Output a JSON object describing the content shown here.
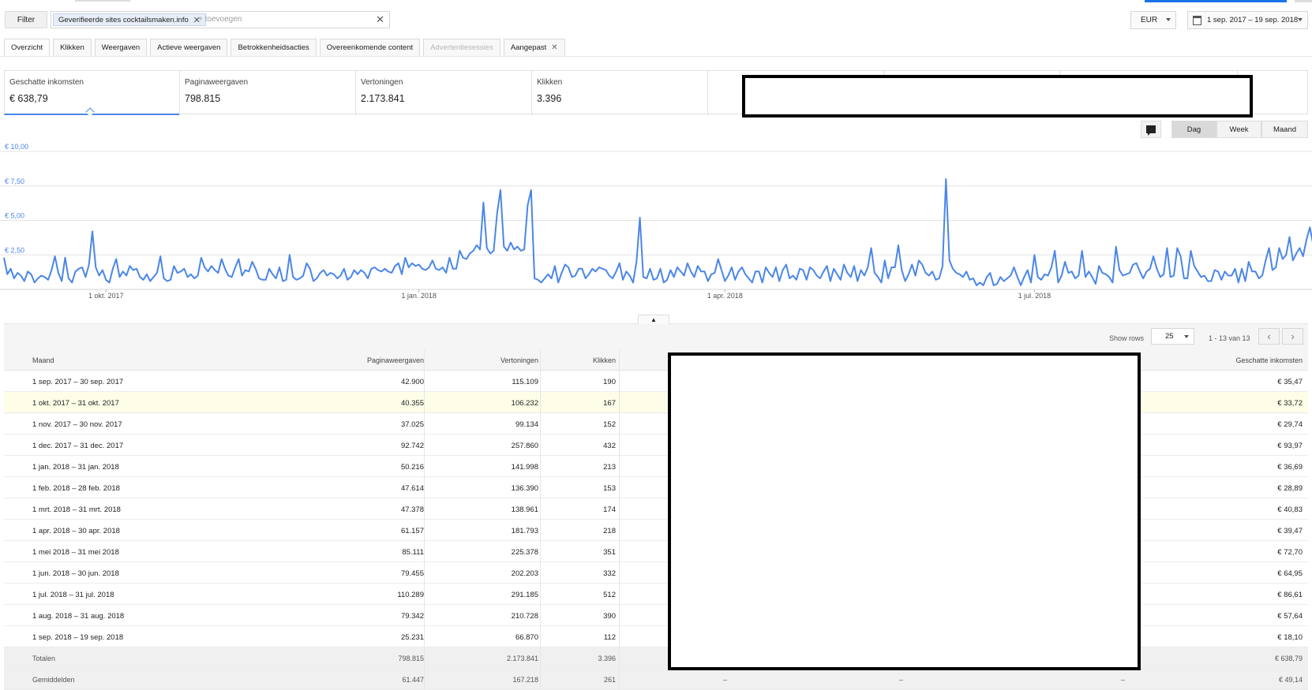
{
  "filter": {
    "button_label": "Filter",
    "chip_label": "Geverifieerde sites cocktailsmaken.info",
    "add_placeholder": "+ toevoegen"
  },
  "currency": "EUR",
  "date_range": "1 sep. 2017 – 19 sep. 2018",
  "tabs": [
    {
      "label": "Overzicht"
    },
    {
      "label": "Klikken"
    },
    {
      "label": "Weergaven"
    },
    {
      "label": "Actieve weergaven"
    },
    {
      "label": "Betrokkenheidsacties"
    },
    {
      "label": "Overeenkomende content"
    },
    {
      "label": "Advertentiesessies"
    },
    {
      "label": "Aangepast"
    }
  ],
  "metrics": [
    {
      "label": "Geschatte inkomsten",
      "value": "€ 638,79"
    },
    {
      "label": "Paginaweergaven",
      "value": "798.815"
    },
    {
      "label": "Vertoningen",
      "value": "2.173.841"
    },
    {
      "label": "Klikken",
      "value": "3.396"
    }
  ],
  "granularity": {
    "day": "Dag",
    "week": "Week",
    "month": "Maand",
    "selected": "Dag"
  },
  "chart_data": {
    "type": "line",
    "title": "",
    "xlabel": "",
    "ylabel": "",
    "ylim": [
      0,
      10
    ],
    "y_ticks": [
      "€ 10,00",
      "€ 7,50",
      "€ 5,00",
      "€ 2,50"
    ],
    "y_tick_values": [
      10,
      7.5,
      5,
      2.5
    ],
    "x_ticks": [
      "1 okt. 2017",
      "1 jan. 2018",
      "1 apr. 2018",
      "1 jul. 2018"
    ],
    "x_tick_index": [
      30,
      122,
      212,
      303
    ],
    "x_count": 384,
    "color": "#4a86e8",
    "series": [
      {
        "values": [
          2.3,
          1.1,
          1.5,
          0.8,
          1.2,
          1.0,
          0.6,
          1.3,
          1.1,
          0.5,
          0.8,
          1.0,
          0.9,
          0.7,
          1.4,
          2.4,
          1.2,
          0.6,
          2.3,
          0.8,
          0.5,
          1.3,
          1.5,
          1.6,
          0.9,
          1.8,
          4.2,
          1.6,
          1.0,
          1.4,
          0.7,
          0.5,
          1.5,
          2.2,
          0.9,
          1.3,
          1.0,
          1.7,
          1.4,
          1.5,
          0.9,
          0.7,
          1.1,
          0.6,
          0.9,
          1.2,
          2.4,
          0.8,
          0.6,
          0.7,
          1.7,
          1.2,
          1.3,
          1.5,
          0.9,
          1.1,
          0.8,
          1.0,
          2.3,
          1.6,
          1.3,
          1.7,
          1.4,
          1.2,
          2.2,
          1.5,
          1.0,
          0.9,
          1.6,
          2.2,
          1.0,
          1.4,
          1.3,
          2.0,
          1.5,
          0.8,
          0.7,
          0.7,
          1.5,
          1.1,
          0.8,
          1.6,
          0.6,
          0.7,
          2.5,
          0.9,
          0.7,
          0.8,
          1.0,
          1.9,
          1.5,
          0.6,
          0.8,
          1.2,
          1.4,
          1.0,
          1.2,
          1.1,
          0.8,
          1.0,
          1.5,
          0.7,
          0.9,
          1.4,
          1.1,
          1.4,
          1.2,
          0.8,
          1.5,
          1.6,
          1.4,
          1.3,
          1.5,
          1.3,
          1.2,
          1.7,
          1.9,
          1.1,
          2.3,
          1.6,
          1.9,
          1.7,
          1.8,
          1.5,
          1.4,
          1.6,
          2.1,
          1.5,
          1.4,
          1.6,
          1.2,
          2.3,
          1.5,
          1.5,
          2.8,
          2.3,
          2.2,
          2.6,
          2.8,
          3.2,
          2.9,
          6.3,
          3.0,
          2.6,
          2.8,
          5.5,
          7.2,
          3.1,
          2.8,
          3.4,
          2.9,
          3.1,
          2.8,
          2.9,
          6.1,
          7.2,
          0.8,
          0.7,
          0.5,
          0.8,
          1.1,
          0.8,
          1.7,
          0.5,
          1.2,
          1.8,
          1.6,
          0.9,
          1.0,
          1.5,
          1.5,
          0.8,
          1.1,
          1.5,
          1.3,
          1.6,
          1.5,
          1.4,
          1.0,
          0.8,
          1.3,
          1.9,
          0.7,
          1.3,
          1.0,
          0.5,
          2.0,
          5.2,
          0.9,
          0.8,
          1.5,
          0.7,
          0.8,
          1.5,
          0.5,
          0.7,
          1.4,
          0.9,
          1.6,
          1.3,
          1.0,
          1.9,
          1.3,
          0.9,
          1.7,
          1.3,
          1.3,
          0.6,
          1.1,
          1.2,
          2.2,
          1.4,
          0.6,
          1.0,
          1.6,
          0.7,
          1.3,
          1.6,
          1.1,
          0.8,
          0.5,
          1.3,
          1.3,
          0.5,
          1.6,
          1.2,
          0.9,
          1.6,
          0.6,
          1.4,
          1.8,
          0.8,
          1.0,
          0.7,
          1.5,
          1.4,
          0.7,
          1.6,
          1.4,
          1.0,
          0.8,
          1.3,
          1.7,
          0.6,
          1.5,
          1.1,
          0.7,
          1.8,
          1.2,
          0.9,
          1.7,
          0.6,
          1.4,
          1.0,
          1.6,
          3.0,
          1.2,
          0.9,
          0.5,
          2.1,
          0.8,
          1.6,
          1.6,
          3.2,
          1.4,
          0.6,
          1.1,
          1.8,
          1.0,
          2.1,
          1.8,
          1.2,
          1.0,
          1.3,
          0.7,
          0.8,
          1.7,
          8.0,
          2.1,
          1.5,
          1.2,
          1.1,
          0.9,
          1.3,
          0.7,
          0.8,
          0.3,
          0.5,
          0.3,
          0.9,
          1.2,
          0.3,
          0.4,
          0.9,
          0.6,
          0.8,
          1.0,
          1.6,
          0.9,
          0.3,
          0.9,
          1.4,
          0.5,
          2.5,
          0.9,
          0.7,
          1.1,
          1.0,
          1.6,
          2.8,
          0.5,
          1.0,
          2.0,
          1.2,
          1.3,
          0.8,
          1.0,
          2.8,
          0.9,
          1.3,
          0.9,
          0.4,
          1.7,
          1.2,
          1.1,
          0.9,
          0.5,
          3.1,
          1.4,
          1.0,
          1.1,
          1.2,
          1.8,
          1.9,
          1.3,
          0.8,
          1.3,
          1.5,
          2.4,
          1.5,
          0.9,
          1.1,
          3.0,
          0.9,
          1.0,
          3.0,
          2.4,
          0.8,
          0.8,
          2.8,
          1.7,
          1.3,
          0.9,
          1.0,
          0.6,
          0.6,
          1.4,
          1.3,
          0.7,
          1.3,
          1.0,
          1.0,
          1.5,
          0.5,
          1.5,
          0.6,
          2.0,
          1.3,
          1.3,
          0.8,
          1.0,
          2.1,
          3.0,
          1.4,
          1.6,
          3.0,
          2.2,
          2.5,
          3.8,
          2.1,
          2.6,
          3.0,
          2.4,
          3.6,
          4.5,
          3.2,
          2.6,
          3.0,
          3.5
        ]
      }
    ]
  },
  "table": {
    "show_rows_label": "Show rows",
    "rows_per_page": "25",
    "page_info": "1 - 13 van 13",
    "headers": {
      "month": "Maand",
      "pageviews": "Paginaweergaven",
      "impressions": "Vertoningen",
      "clicks": "Klikken",
      "earnings": "Geschatte inkomsten"
    },
    "rows": [
      {
        "month": "1 sep. 2017 – 30 sep. 2017",
        "pageviews": "42.900",
        "impressions": "115.109",
        "clicks": "190",
        "earnings": "€ 35,47"
      },
      {
        "month": "1 okt. 2017 – 31 okt. 2017",
        "pageviews": "40.355",
        "impressions": "106.232",
        "clicks": "167",
        "earnings": "€ 33,72"
      },
      {
        "month": "1 nov. 2017 – 30 nov. 2017",
        "pageviews": "37.025",
        "impressions": "99.134",
        "clicks": "152",
        "earnings": "€ 29,74"
      },
      {
        "month": "1 dec. 2017 – 31 dec. 2017",
        "pageviews": "92.742",
        "impressions": "257.860",
        "clicks": "432",
        "earnings": "€ 93,97"
      },
      {
        "month": "1 jan. 2018 – 31 jan. 2018",
        "pageviews": "50.216",
        "impressions": "141.998",
        "clicks": "213",
        "earnings": "€ 36,69"
      },
      {
        "month": "1 feb. 2018 – 28 feb. 2018",
        "pageviews": "47.614",
        "impressions": "136.390",
        "clicks": "153",
        "earnings": "€ 28,89"
      },
      {
        "month": "1 mrt. 2018 – 31 mrt. 2018",
        "pageviews": "47.378",
        "impressions": "138.961",
        "clicks": "174",
        "earnings": "€ 40,83"
      },
      {
        "month": "1 apr. 2018 – 30 apr. 2018",
        "pageviews": "61.157",
        "impressions": "181.793",
        "clicks": "218",
        "earnings": "€ 39,47"
      },
      {
        "month": "1 mei 2018 – 31 mei 2018",
        "pageviews": "85.111",
        "impressions": "225.378",
        "clicks": "351",
        "earnings": "€ 72,70"
      },
      {
        "month": "1 jun. 2018 – 30 jun. 2018",
        "pageviews": "79.455",
        "impressions": "202.203",
        "clicks": "332",
        "earnings": "€ 64,95"
      },
      {
        "month": "1 jul. 2018 – 31 jul. 2018",
        "pageviews": "110.289",
        "impressions": "291.185",
        "clicks": "512",
        "earnings": "€ 86,61"
      },
      {
        "month": "1 aug. 2018 – 31 aug. 2018",
        "pageviews": "79.342",
        "impressions": "210.728",
        "clicks": "390",
        "earnings": "€ 57,64"
      },
      {
        "month": "1 sep. 2018 – 19 sep. 2018",
        "pageviews": "25.231",
        "impressions": "66.870",
        "clicks": "112",
        "earnings": "€ 18,10"
      }
    ],
    "totals": {
      "label": "Totalen",
      "pageviews": "798.815",
      "impressions": "2.173.841",
      "clicks": "3.396",
      "earnings": "€ 638,79"
    },
    "averages": {
      "label": "Gemiddelden",
      "pageviews": "61.447",
      "impressions": "167.218",
      "clicks": "261",
      "dash1": "–",
      "dash2": "–",
      "dash3": "–",
      "earnings": "€ 49,14"
    }
  }
}
